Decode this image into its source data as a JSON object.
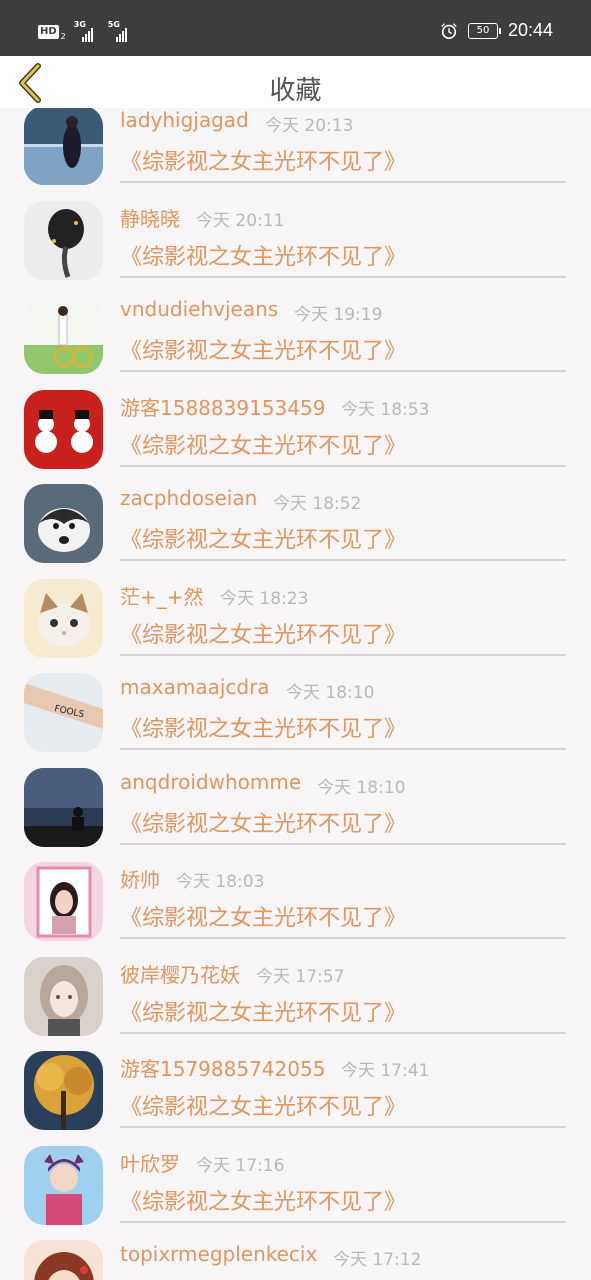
{
  "status_bar": {
    "hd_label": "HD",
    "sim1_sub": "2",
    "sim1_network": "3G",
    "sim2_network": "5G",
    "battery": "50",
    "time": "20:44",
    "alarm_icon": "alarm-clock-icon"
  },
  "header": {
    "title": "收藏",
    "back_icon": "chevron-left-icon",
    "accent": "#e8c23a"
  },
  "colors": {
    "name": "#e0965e",
    "time": "#b9b9b9",
    "book": "#e0965e",
    "divider": "#d3d3d3",
    "background": "#f8f5f6"
  },
  "items": [
    {
      "name": "ladyhigjagad",
      "time": "今天 20:13",
      "book": "《综影视之女主光环不见了》"
    },
    {
      "name": "静晓晓",
      "time": "今天 20:11",
      "book": "《综影视之女主光环不见了》"
    },
    {
      "name": "vndudiehvjeans",
      "time": "今天 19:19",
      "book": "《综影视之女主光环不见了》"
    },
    {
      "name": "游客1588839153459",
      "time": "今天 18:53",
      "book": "《综影视之女主光环不见了》"
    },
    {
      "name": "zacphdoseian",
      "time": "今天 18:52",
      "book": "《综影视之女主光环不见了》"
    },
    {
      "name": "茫+_+然",
      "time": "今天 18:23",
      "book": "《综影视之女主光环不见了》"
    },
    {
      "name": "maxamaajcdra",
      "time": "今天 18:10",
      "book": "《综影视之女主光环不见了》"
    },
    {
      "name": "anqdroidwhomme",
      "time": "今天 18:10",
      "book": "《综影视之女主光环不见了》"
    },
    {
      "name": "娇帅",
      "time": "今天 18:03",
      "book": "《综影视之女主光环不见了》"
    },
    {
      "name": "彼岸樱乃花妖",
      "time": "今天 17:57",
      "book": "《综影视之女主光环不见了》"
    },
    {
      "name": "游客1579885742055",
      "time": "今天 17:41",
      "book": "《综影视之女主光环不见了》"
    },
    {
      "name": "叶欣罗",
      "time": "今天 17:16",
      "book": "《综影视之女主光环不见了》"
    },
    {
      "name": "topixrmegplenkecix",
      "time": "今天 17:12",
      "book": ""
    }
  ]
}
